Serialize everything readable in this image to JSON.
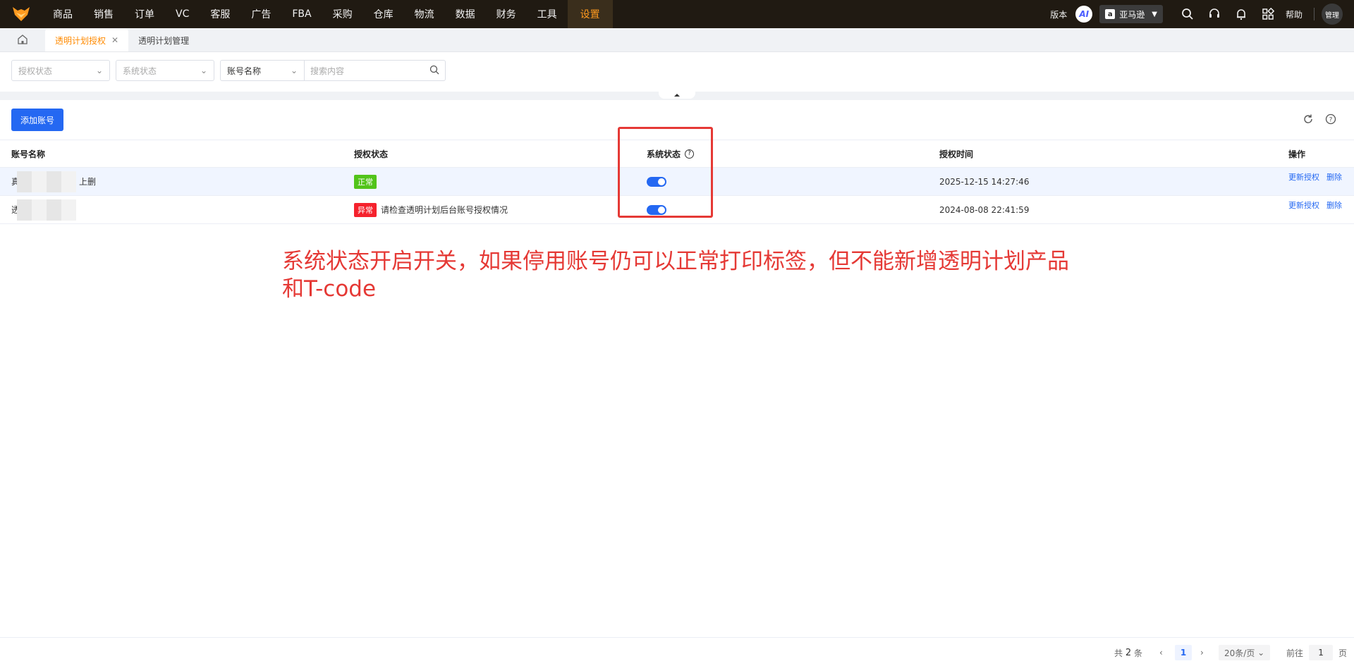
{
  "nav": {
    "items": [
      "商品",
      "销售",
      "订单",
      "VC",
      "客服",
      "广告",
      "FBA",
      "采购",
      "仓库",
      "物流",
      "数据",
      "财务",
      "工具",
      "设置"
    ],
    "active_index": 13,
    "version_label": "版本",
    "ai_label": "AI",
    "store_label": "亚马逊",
    "help_label": "帮助",
    "user_label": "管理"
  },
  "tabs": {
    "items": [
      {
        "label": "透明计划授权",
        "active": true
      },
      {
        "label": "透明计划管理",
        "active": false
      }
    ],
    "close_glyph": "✕"
  },
  "filters": {
    "auth_status_placeholder": "授权状态",
    "system_status_placeholder": "系统状态",
    "field_select_value": "账号名称",
    "search_placeholder": "搜索内容"
  },
  "toolbar": {
    "add_button": "添加账号"
  },
  "table": {
    "headers": {
      "account": "账号名称",
      "auth_status": "授权状态",
      "system_status": "系统状态",
      "auth_time": "授权时间",
      "actions": "操作"
    },
    "rows": [
      {
        "account_prefix": "真",
        "account_suffix": "上删",
        "auth_tag": "正常",
        "auth_note": "",
        "system_on": true,
        "auth_time": "2025-12-15 14:27:46",
        "action_update": "更新授权",
        "action_delete": "删除"
      },
      {
        "account_prefix": "透",
        "account_suffix": "",
        "auth_tag": "异常",
        "auth_note": "请检查透明计划后台账号授权情况",
        "system_on": true,
        "auth_time": "2024-08-08 22:41:59",
        "action_update": "更新授权",
        "action_delete": "删除"
      }
    ]
  },
  "annotation": {
    "text": "系统状态开启开关，如果停用账号仍可以正常打印标签，但不能新增透明计划产品和T-code"
  },
  "pagination": {
    "total_prefix": "共",
    "total": "2",
    "total_suffix": "条",
    "current_page": "1",
    "page_size": "20条/页",
    "goto_prefix": "前往",
    "goto_value": "1",
    "goto_suffix": "页"
  },
  "colors": {
    "primary": "#2468f2",
    "nav_bg": "#201a12",
    "nav_active": "#ff9a1f",
    "ok": "#52c41a",
    "error": "#f5222d",
    "annotation": "#e53935"
  }
}
